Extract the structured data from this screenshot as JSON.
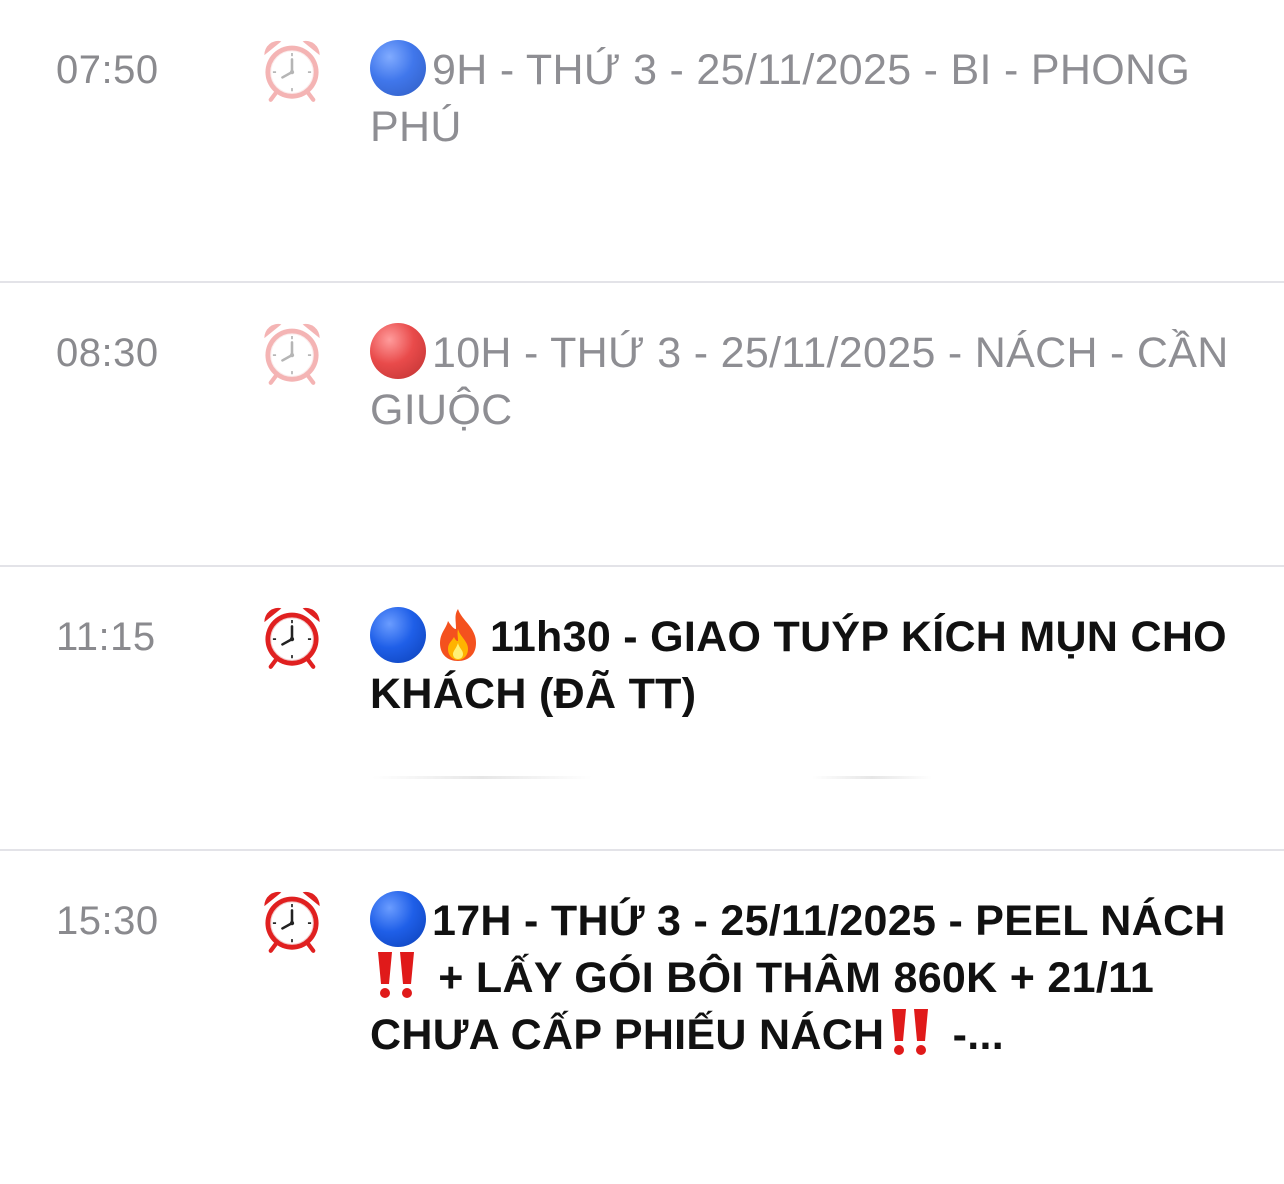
{
  "reminders": [
    {
      "time": "07:50",
      "text": "9H - THỨ 3 - 25/11/2025 - BI - PHONG PHÚ",
      "status": "past",
      "dot_color": "#1f5fe8"
    },
    {
      "time": "08:30",
      "text": "10H - THỨ 3 - 25/11/2025 - NÁCH - CẦN GIUỘC",
      "status": "past",
      "dot_color": "#e52b2b"
    },
    {
      "time": "11:15",
      "text": "11h30 - GIAO TUÝP KÍCH MỤN CHO KHÁCH (ĐÃ TT)",
      "status": "upcoming",
      "dot_color": "#1f5fe8",
      "icons": [
        "blue-circle-icon",
        "fire-icon"
      ]
    },
    {
      "time": "15:30",
      "text_parts": [
        "17H - THỨ 3 - 25/11/2025 - PEEL NÁCH",
        " + LẤY GÓI BÔI THÂM 860K + 21/11 CHƯA CẤP PHIẾU NÁCH",
        " -..."
      ],
      "status": "upcoming",
      "dot_color": "#1f5fe8",
      "icons": [
        "blue-circle-icon",
        "double-exclamation-icon"
      ]
    }
  ],
  "colors": {
    "past_text": "#8e8e93",
    "active_text": "#111111",
    "time_text": "#8a8a8e",
    "divider": "#e3e3e8",
    "alarm_red": "#e02020"
  }
}
